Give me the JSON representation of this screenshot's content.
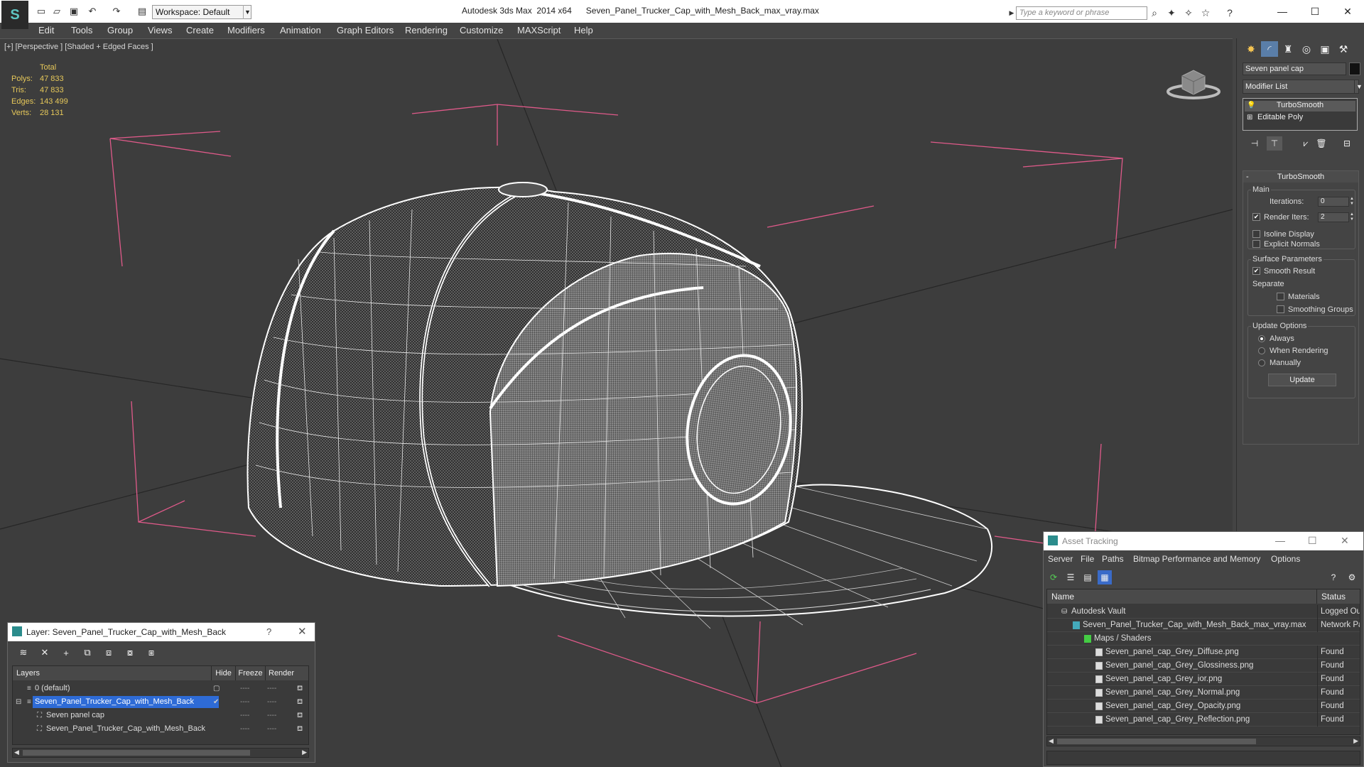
{
  "app": {
    "title": "Autodesk 3ds Max  2014 x64      Seven_Panel_Trucker_Cap_with_Mesh_Back_max_vray.max",
    "workspace": "Workspace: Default",
    "search_placeholder": "Type a keyword or phrase"
  },
  "menu": [
    "Edit",
    "Tools",
    "Group",
    "Views",
    "Create",
    "Modifiers",
    "Animation",
    "Graph Editors",
    "Rendering",
    "Customize",
    "MAXScript",
    "Help"
  ],
  "viewport": {
    "label": "[+] [Perspective ] [Shaded + Edged Faces ]",
    "stats": {
      "header": "Total",
      "rows": [
        {
          "label": "Polys:",
          "value": "47 833"
        },
        {
          "label": "Tris:",
          "value": "47 833"
        },
        {
          "label": "Edges:",
          "value": "143 499"
        },
        {
          "label": "Verts:",
          "value": "28 131"
        }
      ]
    },
    "colors": {
      "background": "#3d3d3d",
      "wire": "#ffffff",
      "bbox": "#e05a8a",
      "grid": "#222222",
      "stats": "#e6c85a"
    }
  },
  "command_panel": {
    "object_name": "Seven panel cap",
    "modifier_list": "Modifier List",
    "stack": [
      "TurboSmooth",
      "Editable Poly"
    ],
    "turbosmooth": {
      "title": "TurboSmooth",
      "main_label": "Main",
      "iterations_label": "Iterations:",
      "iterations": "0",
      "render_iters_label": "Render Iters:",
      "render_iters": "2",
      "isoline": "Isoline Display",
      "explicit_normals": "Explicit Normals",
      "surface_params": "Surface Parameters",
      "smooth_result": "Smooth Result",
      "separate": "Separate",
      "materials": "Materials",
      "smoothing_groups": "Smoothing Groups",
      "update_options": "Update Options",
      "always": "Always",
      "when_rendering": "When Rendering",
      "manually": "Manually",
      "update_button": "Update"
    }
  },
  "layer_dialog": {
    "title": "Layer: Seven_Panel_Trucker_Cap_with_Mesh_Back",
    "columns": [
      "Layers",
      "Hide",
      "Freeze",
      "Render"
    ],
    "rows": [
      {
        "name": "0 (default)",
        "indent": 0,
        "selected": false
      },
      {
        "name": "Seven_Panel_Trucker_Cap_with_Mesh_Back",
        "indent": 0,
        "selected": true
      },
      {
        "name": "Seven panel cap",
        "indent": 1,
        "selected": false
      },
      {
        "name": "Seven_Panel_Trucker_Cap_with_Mesh_Back",
        "indent": 1,
        "selected": false
      }
    ]
  },
  "asset_dialog": {
    "title": "Asset Tracking",
    "menu": [
      "Server",
      "File",
      "Paths",
      "Bitmap Performance and Memory",
      "Options"
    ],
    "columns": [
      "Name",
      "Status"
    ],
    "rows": [
      {
        "name": "Autodesk Vault",
        "status": "Logged Out"
      },
      {
        "name": "Seven_Panel_Trucker_Cap_with_Mesh_Back_max_vray.max",
        "status": "Network Path"
      },
      {
        "name": "Maps / Shaders",
        "status": ""
      },
      {
        "name": "Seven_panel_cap_Grey_Diffuse.png",
        "status": "Found"
      },
      {
        "name": "Seven_panel_cap_Grey_Glossiness.png",
        "status": "Found"
      },
      {
        "name": "Seven_panel_cap_Grey_ior.png",
        "status": "Found"
      },
      {
        "name": "Seven_panel_cap_Grey_Normal.png",
        "status": "Found"
      },
      {
        "name": "Seven_panel_cap_Grey_Opacity.png",
        "status": "Found"
      },
      {
        "name": "Seven_panel_cap_Grey_Reflection.png",
        "status": "Found"
      }
    ]
  }
}
